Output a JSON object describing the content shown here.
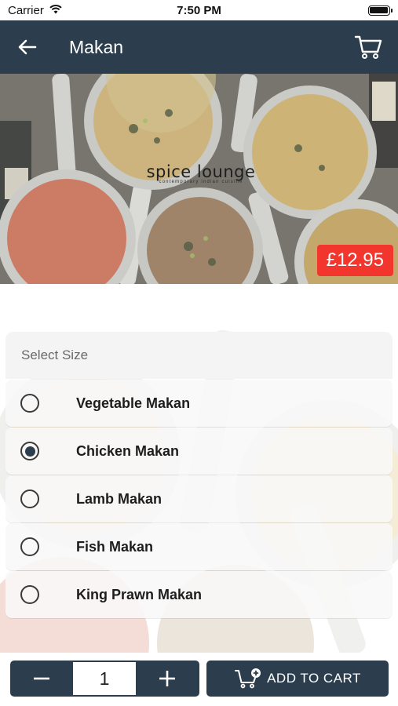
{
  "status_bar": {
    "carrier": "Carrier",
    "time": "7:50 PM",
    "wifi_icon": "wifi-icon",
    "battery_icon": "battery-icon"
  },
  "nav": {
    "title": "Makan",
    "back_icon": "back-arrow-icon",
    "cart_icon": "cart-icon"
  },
  "hero": {
    "logo_name": "spice lounge",
    "logo_tagline": "contemporary indian cuisine",
    "price": "£12.95"
  },
  "options": {
    "header": "Select Size",
    "items": [
      {
        "label": "Vegetable Makan",
        "selected": false
      },
      {
        "label": "Chicken Makan",
        "selected": true
      },
      {
        "label": "Lamb Makan",
        "selected": false
      },
      {
        "label": "Fish Makan",
        "selected": false
      },
      {
        "label": "King Prawn Makan",
        "selected": false
      }
    ]
  },
  "bottom": {
    "quantity": "1",
    "minus_icon": "minus-icon",
    "plus_icon": "plus-icon",
    "add_to_cart_label": "ADD TO CART",
    "add_cart_icon": "cart-add-icon"
  },
  "colors": {
    "primary": "#2c3e4e",
    "price_badge": "#f2362d"
  }
}
